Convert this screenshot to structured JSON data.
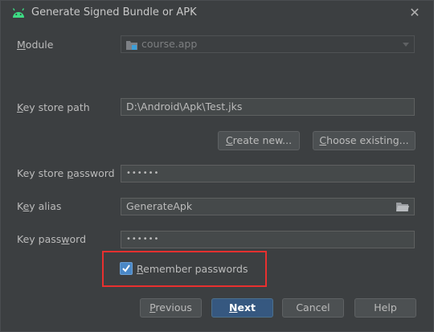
{
  "window": {
    "title": "Generate Signed Bundle or APK",
    "title_icon": "android-icon",
    "close_label": "✕"
  },
  "form": {
    "module": {
      "label_key": "M",
      "label_rest": "odule",
      "value": "course.app"
    },
    "key_store_path": {
      "label_key": "K",
      "label_rest": "ey store path",
      "value": "D:\\Android\\Apk\\Test.jks"
    },
    "create_new": {
      "label_key": "C",
      "label_rest": "reate new..."
    },
    "choose_existing": {
      "label_key": "C",
      "label_rest": "hoose existing..."
    },
    "key_store_password": {
      "label_pre": "Key store ",
      "label_key": "p",
      "label_rest": "assword",
      "value": "••••••"
    },
    "key_alias": {
      "label_pre": "K",
      "label_key": "e",
      "label_rest": "y alias",
      "value": "GenerateApk"
    },
    "key_password": {
      "label_pre": "Key pass",
      "label_key": "w",
      "label_rest": "ord",
      "value": "••••••"
    },
    "remember_passwords": {
      "label_key": "R",
      "label_rest": "emember passwords",
      "checked": true
    }
  },
  "buttons": {
    "previous": {
      "label_key": "P",
      "label_rest": "revious"
    },
    "next": {
      "label_key": "N",
      "label_rest": "ext"
    },
    "cancel": "Cancel",
    "help": "Help"
  },
  "colors": {
    "dialog_bg": "#3c3f41",
    "field_bg": "#45494a",
    "primary_button": "#365880",
    "checkbox": "#4a88c7",
    "highlight_box": "#e8302f",
    "android_green": "#3ddc84"
  }
}
